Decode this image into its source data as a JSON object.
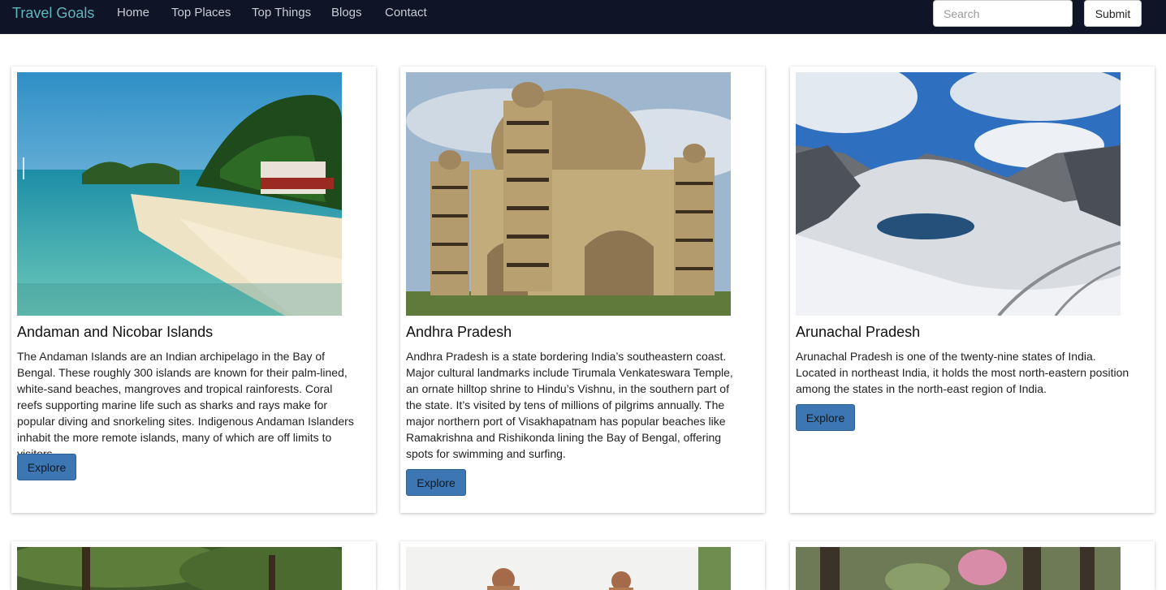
{
  "nav": {
    "brand": "Travel Goals",
    "links": [
      "Home",
      "Top Places",
      "Top Things",
      "Blogs",
      "Contact"
    ],
    "search_placeholder": "Search",
    "submit_label": "Submit"
  },
  "cards": [
    {
      "title": "Andaman and Nicobar Islands",
      "text": "The Andaman Islands are an Indian archipelago in the Bay of Bengal. These roughly 300 islands are known for their palm-lined, white-sand beaches, mangroves and tropical rainforests. Coral reefs supporting marine life such as sharks and rays make for popular diving and snorkeling sites. Indigenous Andaman Islanders inhabit the more remote islands, many of which are off limits to visitors.",
      "button": "Explore"
    },
    {
      "title": "Andhra Pradesh",
      "text": "Andhra Pradesh is a state bordering India’s southeastern coast. Major cultural landmarks include Tirumala Venkateswara Temple, an ornate hilltop shrine to Hindu’s Vishnu, in the southern part of the state. It’s visited by tens of millions of pilgrims annually. The major northern port of Visakhapatnam has popular beaches like Ramakrishna and Rishikonda lining the Bay of Bengal, offering spots for swimming and surfing.",
      "button": "Explore"
    },
    {
      "title": "Arunachal Pradesh",
      "text": "Arunachal Pradesh is one of the twenty-nine states of India. Located in northeast India, it holds the most north-eastern position among the states in the north-east region of India.",
      "button": "Explore"
    }
  ]
}
